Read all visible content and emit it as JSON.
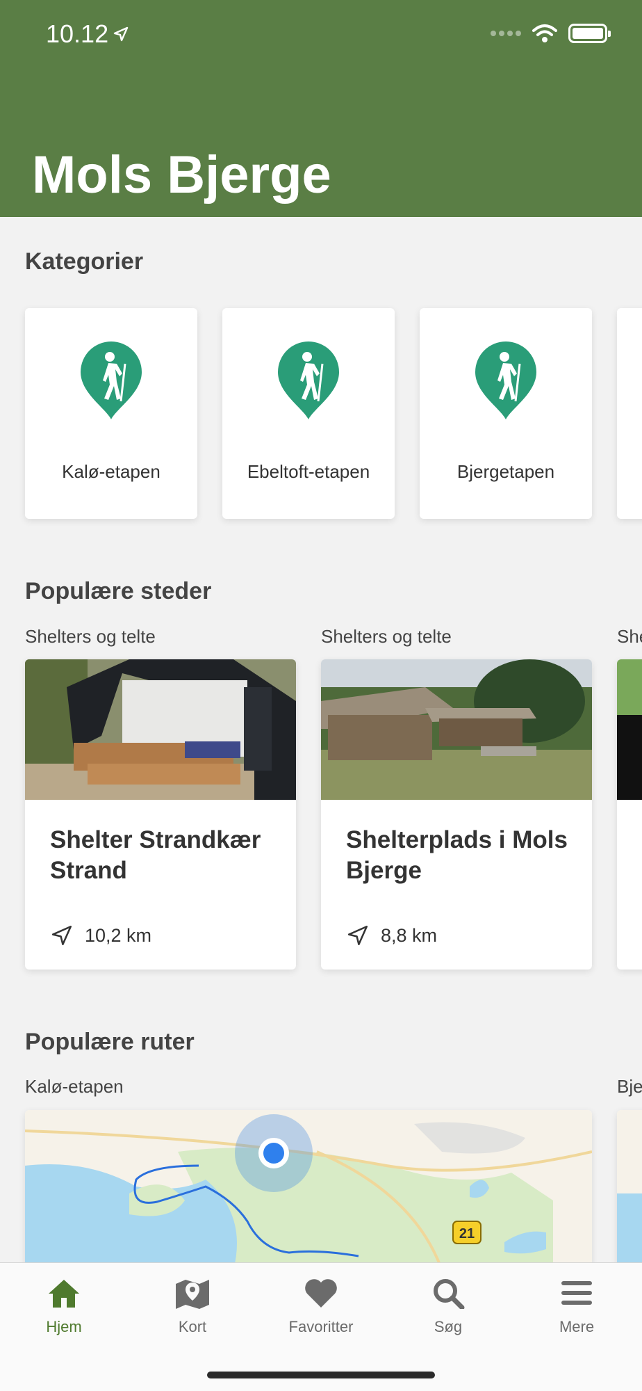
{
  "status": {
    "time": "10.12"
  },
  "header": {
    "title": "Mols Bjerge",
    "color": "#5a7e45"
  },
  "categories": {
    "title": "Kategorier",
    "items": [
      {
        "label": "Kalø-etapen",
        "icon": "hiker-pin-icon"
      },
      {
        "label": "Ebeltoft-etapen",
        "icon": "hiker-pin-icon"
      },
      {
        "label": "Bjergetapen",
        "icon": "hiker-pin-icon"
      }
    ]
  },
  "places": {
    "title": "Populære steder",
    "items": [
      {
        "category": "Shelters og telte",
        "name": "Shelter Strandkær Strand",
        "distance": "10,2 km"
      },
      {
        "category": "Shelters og telte",
        "name": "Shelterplads i Mols Bjerge",
        "distance": "8,8 km"
      },
      {
        "category": "She"
      }
    ]
  },
  "routes": {
    "title": "Populære ruter",
    "items": [
      {
        "name": "Kalø-etapen",
        "road_badge": "21"
      },
      {
        "name": "Bje"
      }
    ]
  },
  "tabbar": {
    "items": [
      {
        "label": "Hjem",
        "icon": "home-icon",
        "active": true
      },
      {
        "label": "Kort",
        "icon": "map-pin-icon",
        "active": false
      },
      {
        "label": "Favoritter",
        "icon": "heart-icon",
        "active": false
      },
      {
        "label": "Søg",
        "icon": "search-icon",
        "active": false
      },
      {
        "label": "Mere",
        "icon": "menu-icon",
        "active": false
      }
    ],
    "active_color": "#4f7a2e"
  }
}
